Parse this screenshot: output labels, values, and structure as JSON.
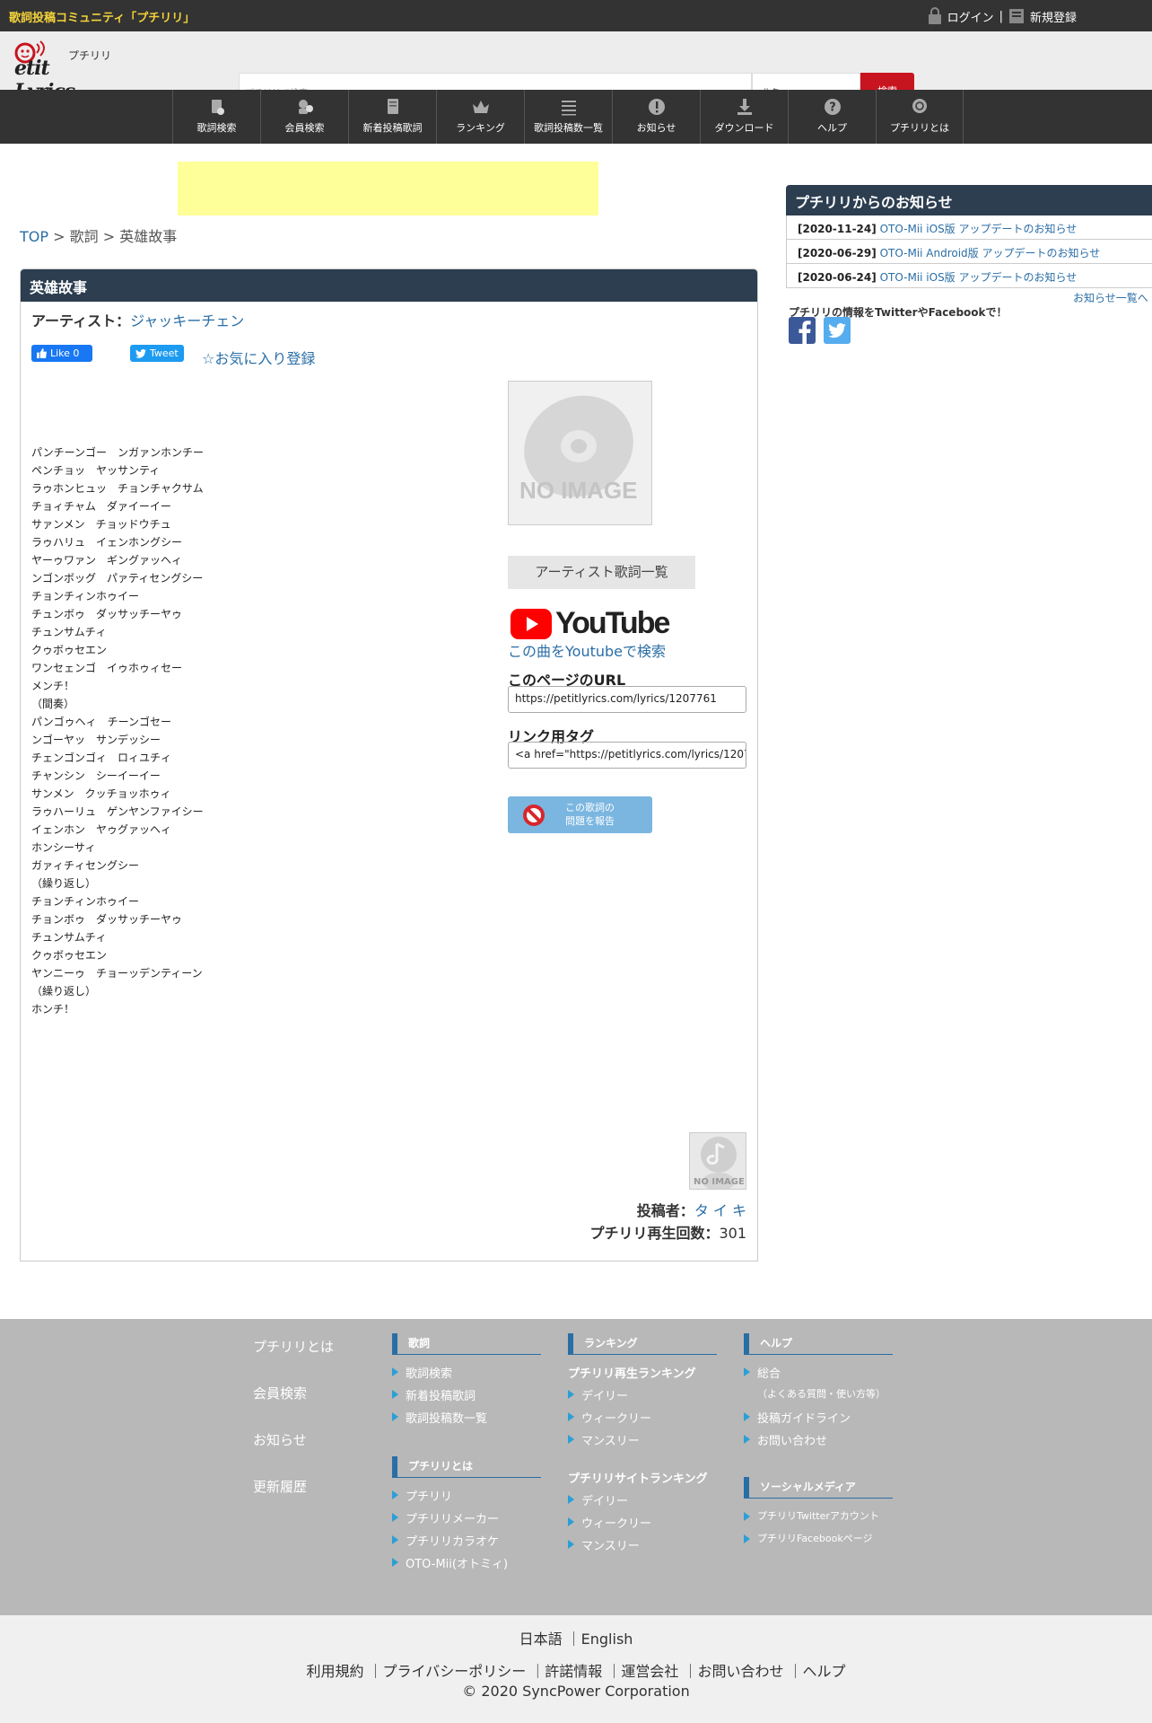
{
  "topbar": {
    "site_title": "歌詞投稿コミュニティ「プチリリ」",
    "login": "ログイン",
    "separator": "|",
    "register": "新規登録"
  },
  "header": {
    "logo_main": "etit Lyrics",
    "logo_sub": "プチリリ",
    "search_placeholder": "プチリリで検索",
    "search_select": "曲名",
    "search_button": "検索"
  },
  "nav": [
    {
      "label": "歌詞検索",
      "icon": "lyrics-search-icon"
    },
    {
      "label": "会員検索",
      "icon": "member-search-icon"
    },
    {
      "label": "新着投稿歌詞",
      "icon": "new-lyrics-icon"
    },
    {
      "label": "ランキング",
      "icon": "crown-icon"
    },
    {
      "label": "歌詞投稿数一覧",
      "icon": "list-icon"
    },
    {
      "label": "お知らせ",
      "icon": "exclamation-icon"
    },
    {
      "label": "ダウンロード",
      "icon": "download-icon"
    },
    {
      "label": "ヘルプ",
      "icon": "question-icon"
    },
    {
      "label": "プチリリとは",
      "icon": "petitlyrics-icon"
    }
  ],
  "breadcrumb": {
    "top": "TOP",
    "sep1": " > ",
    "lyrics": "歌詞",
    "sep2": " > ",
    "current": "英雄故事"
  },
  "song": {
    "title": "英雄故事",
    "artist_label": "アーティスト：",
    "artist": "ジャッキーチェン",
    "like_label": "Like 0",
    "tweet_label": "Tweet",
    "favorite": "☆お気に入り登録",
    "lyrics": [
      "パンチーンゴー　ンガァンホンチー",
      "ペンチョッ　ヤッサンティ",
      "ラゥホンヒュッ　チョンチャクサム",
      "チョィチャム　ダァイーイー",
      "サァンメン　チョッドウチュ",
      "ラゥハリュ　イェンホングシー",
      "ヤーゥワァン　ギングァッヘィ",
      "ンゴンボッグ　パァティセングシー",
      "チョンチィンホゥイー",
      "チュンボゥ　ダッサッチーヤゥ",
      "チュンサムチィ",
      "クゥボゥセエン",
      "ワンセェンゴ　イゥホゥィセー",
      "メンチ！",
      "（間奏）",
      "パンゴゥヘィ　チーンゴセー",
      "ンゴーヤッ　サンデッシー",
      "チェンゴンゴィ　ロィユチィ",
      "チャンシン　シーイーイー",
      "サンメン　クッチョッホゥィ",
      "ラゥハーリュ　ゲンヤンファイシー",
      "イェンホン　ヤゥグァッヘィ",
      "ホンシーサィ",
      "ガァィチィセングシー",
      "（繰り返し）",
      "チョンチィンホゥイー",
      "チョンボゥ　ダッサッチーヤゥ",
      "チュンサムチィ",
      "クゥボゥセエン",
      "ヤンニーゥ　チョーッデンティーン",
      "（繰り返し）",
      "ホンチ！"
    ],
    "no_image": "NO IMAGE",
    "artist_list_button": "アーティスト歌詞一覧",
    "youtube_text": "YouTube",
    "youtube_search": "この曲をYoutubeで検索",
    "url_label": "このページのURL",
    "url_value": "https://petitlyrics.com/lyrics/1207761",
    "tag_label": "リンク用タグ",
    "tag_value": "<a href=\"https://petitlyrics.com/lyrics/1207",
    "report_line1": "この歌詞の",
    "report_line2": "問題を報告",
    "poster_no_image": "NO IMAGE",
    "poster_label": "投稿者：",
    "poster_name": "タ イ キ",
    "plays_label": "プチリリ再生回数：",
    "plays_value": "301"
  },
  "sidebar": {
    "news_title": "プチリリからのお知らせ",
    "news": [
      {
        "date": "[2020-11-24]",
        "text": "OTO-Mii iOS版 アップデートのお知らせ"
      },
      {
        "date": "[2020-06-29]",
        "text": "OTO-Mii Android版 アップデートのお知らせ"
      },
      {
        "date": "[2020-06-24]",
        "text": "OTO-Mii iOS版 アップデートのお知らせ"
      }
    ],
    "news_more": "お知らせ一覧へ",
    "social_text": "プチリリの情報をTwitterやFacebookで！"
  },
  "footer": {
    "col0": [
      "プチリリとは",
      "会員検索",
      "お知らせ",
      "更新履歴"
    ],
    "lyrics_head": "歌詞",
    "lyrics_items": [
      "歌詞検索",
      "新着投稿歌詞",
      "歌詞投稿数一覧"
    ],
    "about_head": "プチリリとは",
    "about_items": [
      "プチリリ",
      "プチリリメーカー",
      "プチリリカラオケ",
      "OTO-Mii(オトミィ)"
    ],
    "ranking_head": "ランキング",
    "ranking_sub1": "プチリリ再生ランキング",
    "ranking_items1": [
      "デイリー",
      "ウィークリー",
      "マンスリー"
    ],
    "ranking_sub2": "プチリリサイトランキング",
    "ranking_items2": [
      "デイリー",
      "ウィークリー",
      "マンスリー"
    ],
    "help_head": "ヘルプ",
    "help_items": [
      "総合",
      "（よくある質問・使い方等）",
      "投稿ガイドライン",
      "お問い合わせ"
    ],
    "social_head": "ソーシャルメディア",
    "social_items": [
      "プチリリTwitterアカウント",
      "プチリリFacebookページ"
    ]
  },
  "bottom": {
    "langs": "日本語 ｜English",
    "links": "利用規約 ｜プライバシーポリシー ｜許諾情報 ｜運営会社 ｜お問い合わせ ｜ヘルプ",
    "copyright": "© 2020 SyncPower Corporation"
  },
  "colors": {
    "dark_bar": "#333333",
    "panel_head": "#2c3e50",
    "accent_red": "#c8141e",
    "link_blue": "#2a6ea6",
    "ad_yellow": "#ffff99",
    "footer_gray": "#b8b8b8"
  }
}
